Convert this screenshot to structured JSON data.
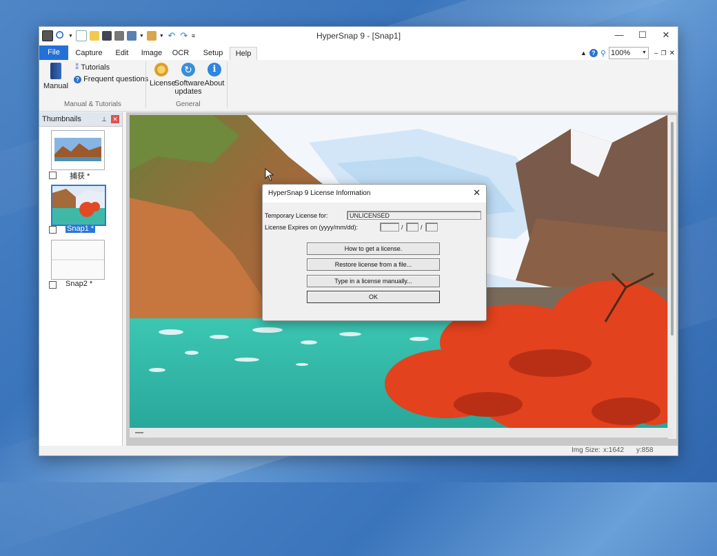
{
  "window": {
    "title": "HyperSnap 9 - [Snap1]",
    "minimize": "—",
    "maximize": "☐",
    "close": "✕"
  },
  "ribbon_tabs": [
    "File",
    "Capture",
    "Edit",
    "Image",
    "OCR",
    "Setup",
    "Help"
  ],
  "ribbon_right": {
    "zoom": "100%"
  },
  "help_ribbon": {
    "manual": "Manual",
    "tutorials": "Tutorials",
    "faq": "Frequent questions",
    "group1": "Manual & Tutorials",
    "license": "License",
    "software_updates_l1": "Software",
    "software_updates_l2": "updates",
    "about": "About",
    "group2": "General"
  },
  "thumbnails": {
    "title": "Thumbnails",
    "items": [
      {
        "label": "捕获 *"
      },
      {
        "label": "Snap1 *"
      },
      {
        "label": "Snap2 *"
      }
    ]
  },
  "status": {
    "img_size_label": "Img Size:",
    "x": "x:1642",
    "y": "y:858"
  },
  "dialog": {
    "title": "HyperSnap 9 License Information",
    "temp_license_label": "Temporary License for:",
    "temp_license_value": "UNLICENSED",
    "expires_label": "License Expires on (yyyy/mm/dd):",
    "date_sep": "/",
    "buttons": [
      "How to get a license.",
      "Restore license from a file...",
      "Type in a license manually...",
      "OK"
    ]
  }
}
